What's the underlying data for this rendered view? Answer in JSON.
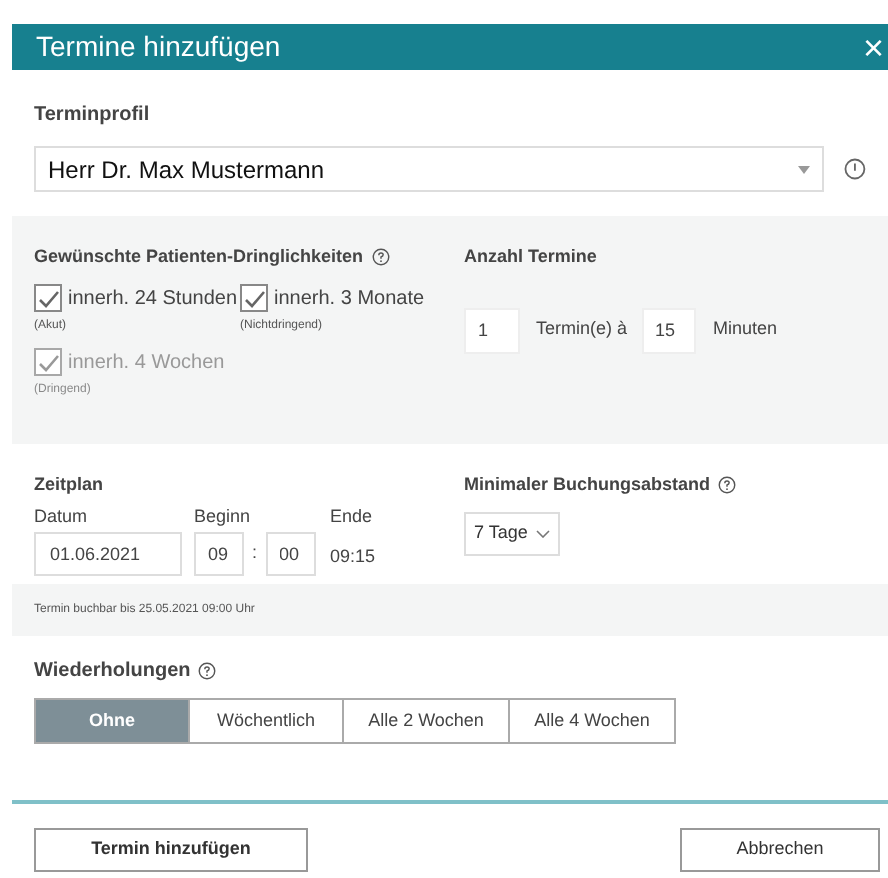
{
  "dialog": {
    "title": "Termine hinzufügen",
    "close": "×"
  },
  "profile": {
    "label": "Terminprofil",
    "value": "Herr Dr. Max Mustermann"
  },
  "urgencies": {
    "label": "Gewünschte Patienten-Dringlichkeiten",
    "items": [
      {
        "label": "innerh. 24 Stunden",
        "sub": "(Akut)",
        "checked": true,
        "disabled": false
      },
      {
        "label": "innerh. 3 Monate",
        "sub": "(Nichtdringend)",
        "checked": true,
        "disabled": false
      },
      {
        "label": "innerh. 4 Wochen",
        "sub": "(Dringend)",
        "checked": true,
        "disabled": true
      }
    ]
  },
  "count": {
    "label": "Anzahl Termine",
    "count": "1",
    "between": "Termin(e) à",
    "minutes": "15",
    "unit": "Minuten"
  },
  "schedule": {
    "label": "Zeitplan",
    "date_label": "Datum",
    "date": "01.06.2021",
    "start_label": "Beginn",
    "start_hour": "09",
    "sep": ":",
    "start_min": "00",
    "end_label": "Ende",
    "end": "09:15"
  },
  "min_gap": {
    "label": "Minimaler Buchungsabstand",
    "value": "7 Tage"
  },
  "notice": "Termin buchbar bis 25.05.2021 09:00 Uhr",
  "repeat": {
    "label": "Wiederholungen",
    "options": [
      {
        "label": "Ohne",
        "selected": true
      },
      {
        "label": "Wöchentlich",
        "selected": false
      },
      {
        "label": "Alle 2 Wochen",
        "selected": false
      },
      {
        "label": "Alle 4 Wochen",
        "selected": false
      }
    ]
  },
  "buttons": [
    "Termin hinzufügen",
    "Abbrechen"
  ]
}
